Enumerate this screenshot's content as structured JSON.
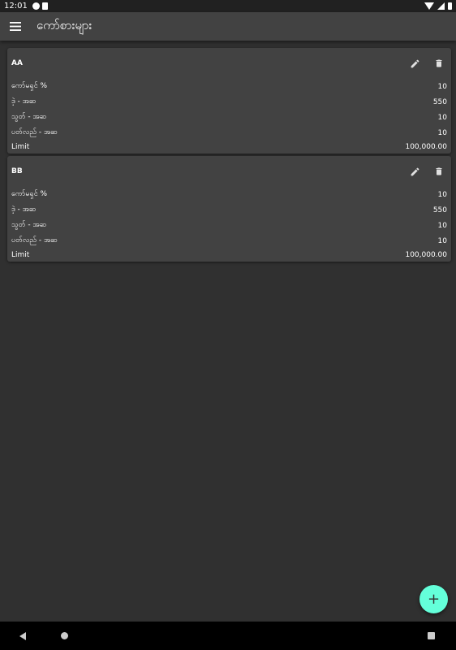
{
  "status_bar": {
    "time": "12:01"
  },
  "app_bar": {
    "title": "ကော်စားများ"
  },
  "cards": [
    {
      "name": "AA",
      "rows": [
        {
          "label": "ကော်မရှင် %",
          "value": "10"
        },
        {
          "label": "ဒဲ့ - အဆ",
          "value": "550"
        },
        {
          "label": "သွတ် - အဆ",
          "value": "10"
        },
        {
          "label": "ပတ်လည် - အဆ",
          "value": "10"
        },
        {
          "label": "Limit",
          "value": "100,000.00"
        }
      ]
    },
    {
      "name": "BB",
      "rows": [
        {
          "label": "ကော်မရှင် %",
          "value": "10"
        },
        {
          "label": "ဒဲ့ - အဆ",
          "value": "550"
        },
        {
          "label": "သွတ် - အဆ",
          "value": "10"
        },
        {
          "label": "ပတ်လည် - အဆ",
          "value": "10"
        },
        {
          "label": "Limit",
          "value": "100,000.00"
        }
      ]
    }
  ],
  "fab": {
    "label": "+"
  },
  "colors": {
    "accent": "#64ffda",
    "background": "#303030",
    "surface": "#424242"
  }
}
